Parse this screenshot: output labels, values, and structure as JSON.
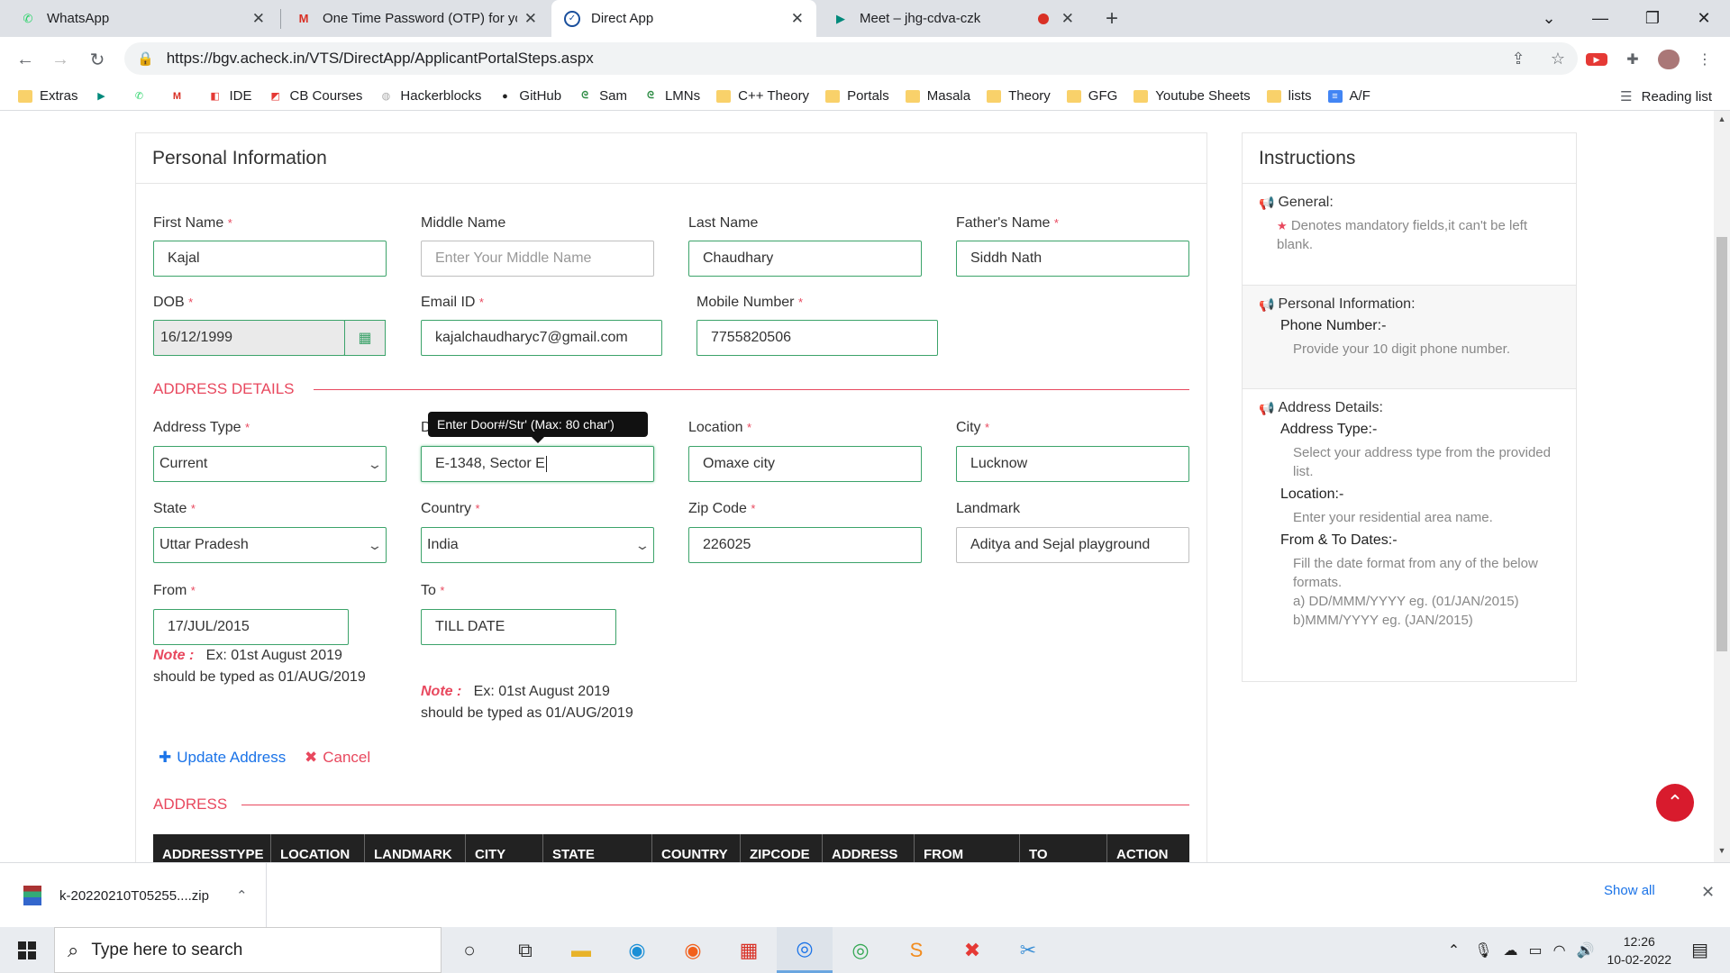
{
  "browser": {
    "tabs": [
      {
        "title": "WhatsApp",
        "icon": "whatsapp-icon"
      },
      {
        "title": "One Time Password (OTP) for you",
        "icon": "gmail-icon"
      },
      {
        "title": "Direct App",
        "icon": "check-circle-icon"
      },
      {
        "title": "Meet – jhg-cdva-czk",
        "icon": "meet-icon"
      }
    ],
    "url": "https://bgv.acheck.in/VTS/DirectApp/ApplicantPortalSteps.aspx",
    "bookmarks": [
      "Extras",
      "IDE",
      "CB Courses",
      "Hackerblocks",
      "GitHub",
      "Sam",
      "LMNs",
      "C++ Theory",
      "Portals",
      "Masala",
      "Theory",
      "GFG",
      "Youtube Sheets",
      "lists",
      "A/F"
    ],
    "reading_list": "Reading list"
  },
  "personal": {
    "title": "Personal Information",
    "labels": {
      "first_name": "First Name",
      "middle_name": "Middle Name",
      "last_name": "Last Name",
      "father_name": "Father's Name",
      "dob": "DOB",
      "email": "Email ID",
      "mobile": "Mobile Number"
    },
    "values": {
      "first_name": "Kajal",
      "middle_name_placeholder": "Enter Your Middle Name",
      "last_name": "Chaudhary",
      "father_name": "Siddh Nath",
      "dob": "16/12/1999",
      "email": "kajalchaudharyc7@gmail.com",
      "mobile": "7755820506"
    }
  },
  "address": {
    "section_title": "ADDRESS DETAILS",
    "labels": {
      "address_type": "Address Type",
      "door_visible": "D",
      "location": "Location",
      "city": "City",
      "state": "State",
      "country": "Country",
      "zip": "Zip Code",
      "landmark": "Landmark",
      "from": "From",
      "to": "To"
    },
    "values": {
      "address_type": "Current",
      "door": "E-1348, Sector E",
      "location": "Omaxe city",
      "city": "Lucknow",
      "state": "Uttar Pradesh",
      "country": "India",
      "zip": "226025",
      "landmark": "Aditya and Sejal playground",
      "from": "17/JUL/2015",
      "to": "TILL DATE"
    },
    "tooltip": "Enter Door#/Str' (Max: 80 char')",
    "note_label": "Note :",
    "note_text_line1": "Ex: 01st August 2019",
    "note_text_line2": "should be typed as 01/AUG/2019",
    "update_label": "Update Address",
    "cancel_label": "Cancel",
    "list_title": "ADDRESS",
    "columns": [
      "ADDRESSTYPE",
      "LOCATION",
      "LANDMARK",
      "CITY",
      "STATE",
      "COUNTRY",
      "ZIPCODE",
      "ADDRESS",
      "FROM",
      "TO",
      "ACTION"
    ]
  },
  "instructions": {
    "title": "Instructions",
    "general_h": "General:",
    "general_txt": "Denotes mandatory fields,it can't be left blank.",
    "personal_h": "Personal Information:",
    "phone_sub": "Phone Number:-",
    "phone_txt": "Provide your 10 digit phone number.",
    "address_h": "Address Details:",
    "addr_type_sub": "Address Type:-",
    "addr_type_txt": "Select your address type from the provided list.",
    "location_sub": "Location:-",
    "location_txt": "Enter your residential area name.",
    "dates_sub": "From & To Dates:-",
    "dates_txt1": "Fill the date format from any of the below formats.",
    "dates_txt2": "a) DD/MMM/YYYY eg. (01/JAN/2015)",
    "dates_txt3": "b)MMM/YYYY eg. (JAN/2015)"
  },
  "download": {
    "file": "k-20220210T05255....zip",
    "show_all": "Show all"
  },
  "taskbar": {
    "search_placeholder": "Type here to search",
    "time": "12:26",
    "date": "10-02-2022"
  },
  "colors": {
    "accent_red": "#e8485e",
    "input_green": "#3ca36a",
    "link_blue": "#1a73e8"
  }
}
